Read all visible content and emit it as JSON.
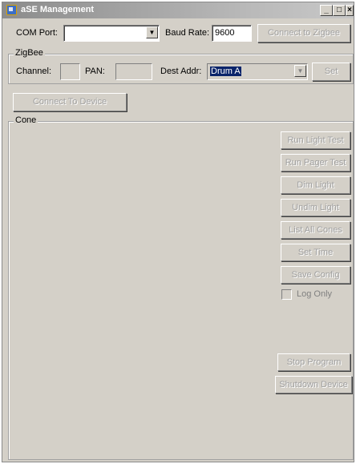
{
  "window": {
    "title": "aSE Management",
    "controls": {
      "minimize": "_",
      "maximize": "□",
      "close": "×"
    }
  },
  "connection": {
    "com_port_label": "COM Port:",
    "com_port_value": "",
    "baud_rate_label": "Baud Rate:",
    "baud_rate_value": "9600",
    "connect_zigbee_label": "Connect to Zigbee"
  },
  "zigbee": {
    "group_label": "ZigBee",
    "channel_label": "Channel:",
    "channel_value": "",
    "pan_label": "PAN:",
    "pan_value": "",
    "dest_addr_label": "Dest Addr:",
    "dest_addr_value": "Drum A",
    "set_label": "Set"
  },
  "connect_device_label": "Connect To Device",
  "cone": {
    "group_label": "Cone",
    "buttons": {
      "run_light_test": "Run Light Test",
      "run_pager_test": "Run Pager Test",
      "dim_light": "Dim Light",
      "undim_light": "Undim Light",
      "list_all_cones": "List All Cones",
      "set_time": "Set Time",
      "save_config": "Save Config"
    },
    "log_only_label": "Log Only",
    "log_only_checked": false,
    "stop_program_label": "Stop Program",
    "shutdown_device_label": "Shutdown Device"
  }
}
